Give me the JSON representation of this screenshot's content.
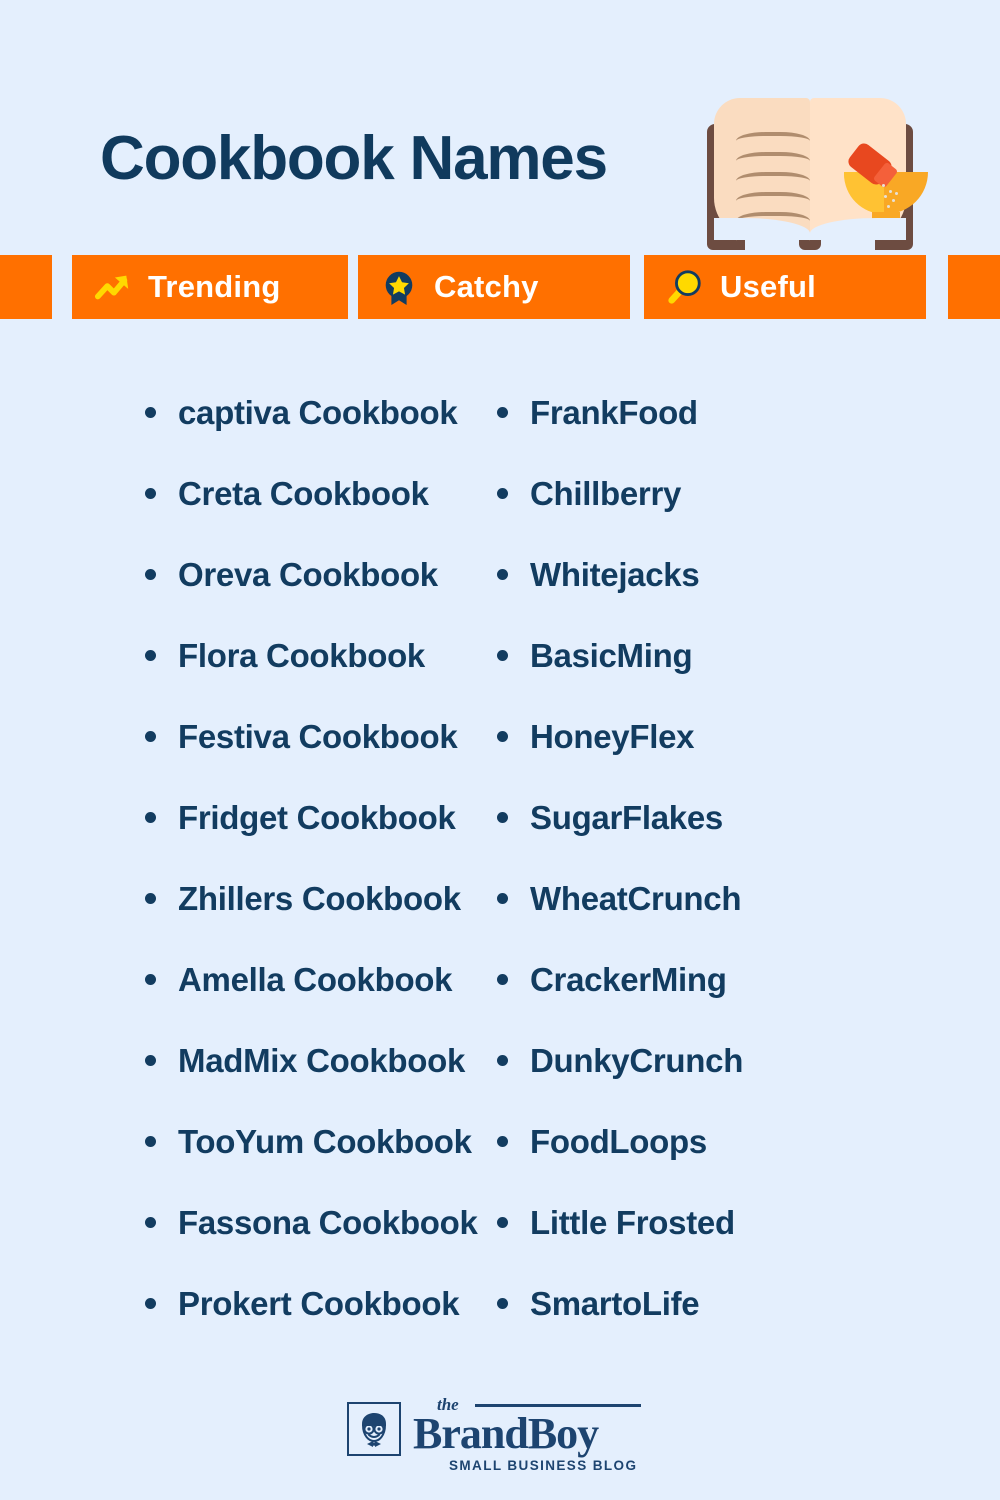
{
  "page": {
    "background_color": "#e4effd",
    "text_color": "#123c60",
    "accent_color": "#ff7000",
    "icon_yellow": "#ffd600"
  },
  "header": {
    "title": "Cookbook Names",
    "illustration": "open-cookbook-with-bowl-icon"
  },
  "badges": [
    {
      "label": "Trending",
      "icon": "trending-up-icon"
    },
    {
      "label": "Catchy",
      "icon": "award-ribbon-star-icon"
    },
    {
      "label": "Useful",
      "icon": "magnifying-glass-icon"
    }
  ],
  "lists": {
    "left_column": [
      "captiva Cookbook",
      "Creta Cookbook",
      "Oreva Cookbook",
      "Flora Cookbook",
      "Festiva Cookbook",
      "Fridget Cookbook",
      "Zhillers Cookbook",
      "Amella Cookbook",
      "MadMix Cookbook",
      "TooYum Cookbook",
      "Fassona Cookbook",
      "Prokert Cookbook"
    ],
    "right_column": [
      "FrankFood",
      "Chillberry",
      "Whitejacks",
      "BasicMing",
      "HoneyFlex",
      "SugarFlakes",
      "WheatCrunch",
      "CrackerMing",
      "DunkyCrunch",
      "FoodLoops",
      "Little Frosted",
      "SmartoLife"
    ]
  },
  "footer": {
    "logo_the": "the",
    "logo_name": "BrandBoy",
    "logo_tagline": "SMALL BUSINESS BLOG",
    "logo_mark": "boy-face-icon"
  }
}
